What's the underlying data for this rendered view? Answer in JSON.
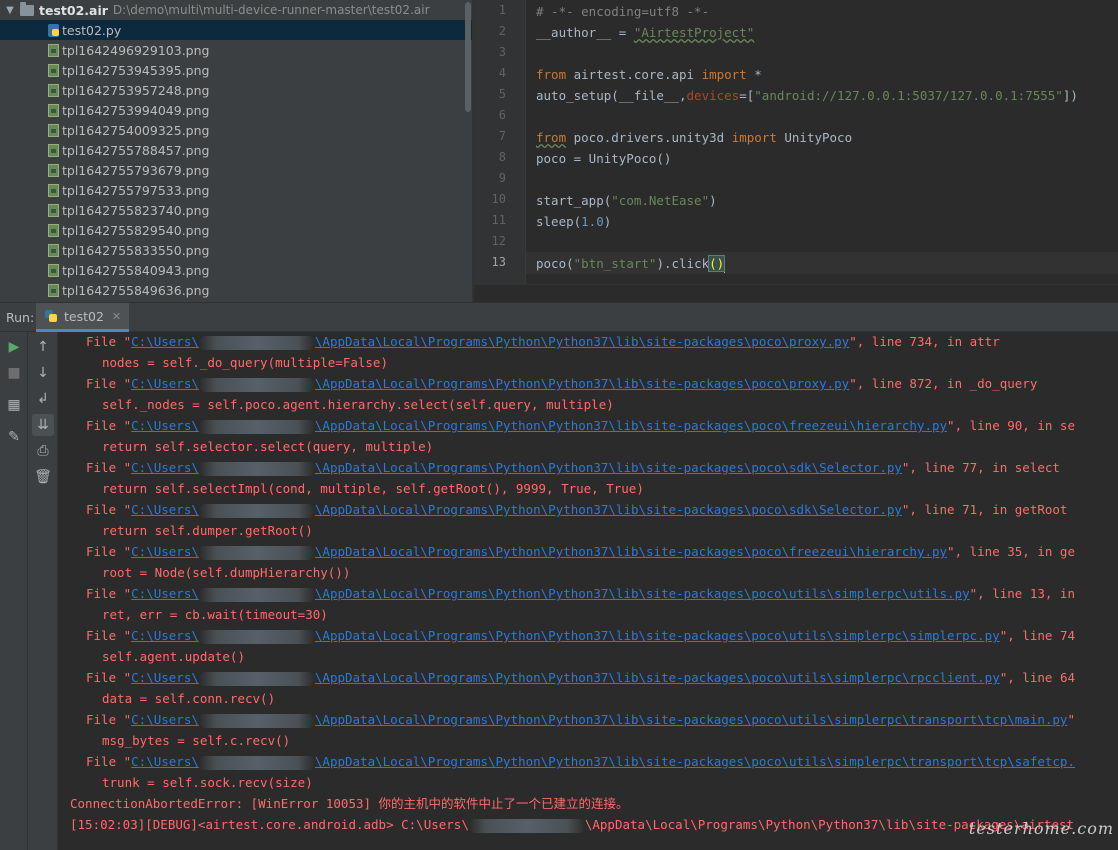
{
  "project_tree": {
    "root_name": "test02.air",
    "root_path": "D:\\demo\\multi\\multi-device-runner-master\\test02.air",
    "files": [
      {
        "name": "test02.py",
        "type": "py",
        "selected": true
      },
      {
        "name": "tpl1642496929103.png",
        "type": "png"
      },
      {
        "name": "tpl1642753945395.png",
        "type": "png"
      },
      {
        "name": "tpl1642753957248.png",
        "type": "png"
      },
      {
        "name": "tpl1642753994049.png",
        "type": "png"
      },
      {
        "name": "tpl1642754009325.png",
        "type": "png"
      },
      {
        "name": "tpl1642755788457.png",
        "type": "png"
      },
      {
        "name": "tpl1642755793679.png",
        "type": "png"
      },
      {
        "name": "tpl1642755797533.png",
        "type": "png"
      },
      {
        "name": "tpl1642755823740.png",
        "type": "png"
      },
      {
        "name": "tpl1642755829540.png",
        "type": "png"
      },
      {
        "name": "tpl1642755833550.png",
        "type": "png"
      },
      {
        "name": "tpl1642755840943.png",
        "type": "png"
      },
      {
        "name": "tpl1642755849636.png",
        "type": "png"
      }
    ]
  },
  "editor": {
    "line_numbers": [
      "1",
      "2",
      "3",
      "4",
      "5",
      "6",
      "7",
      "8",
      "9",
      "10",
      "11",
      "12",
      "13"
    ],
    "current_line": "13",
    "code": {
      "l1": "# -*- encoding=utf8 -*-",
      "l2a": "__author__ = ",
      "l2b": "\"AirtestProject\"",
      "l4a": "from",
      "l4b": " airtest.core.api ",
      "l4c": "import",
      "l4d": " *",
      "l5a": "auto_setup(__file__,",
      "l5b": "devices",
      "l5c": "=[",
      "l5d": "\"android://127.0.0.1:5037/127.0.0.1:7555\"",
      "l5e": "])",
      "l7a": "from",
      "l7b": " poco.drivers.unity3d ",
      "l7c": "import",
      "l7d": " UnityPoco",
      "l8": "poco = UnityPoco()",
      "l10a": "start_app(",
      "l10b": "\"com.NetEase\"",
      "l10c": ")",
      "l11a": "sleep(",
      "l11b": "1.0",
      "l11c": ")",
      "l13a": "poco(",
      "l13b": "\"btn_start\"",
      "l13c": ").click",
      "l13d": "()"
    }
  },
  "run_window": {
    "label": "Run:",
    "tab_label": "test02",
    "toolbar_icons": [
      "run-icon",
      "stop-icon",
      "layout-icon",
      "pin-icon",
      "up-arrow-icon",
      "down-arrow-icon",
      "soft-wrap-icon",
      "scroll-to-end-icon",
      "print-icon",
      "trash-icon"
    ]
  },
  "console": {
    "file_prefix": "File \"",
    "user_path_start": "C:\\Users\\",
    "frames": [
      {
        "path": "\\AppData\\Local\\Programs\\Python\\Python37\\lib\\site-packages\\poco\\proxy.py",
        "suffix": "\", line 734, in attr",
        "code": "nodes = self._do_query(multiple=False)"
      },
      {
        "path": "\\AppData\\Local\\Programs\\Python\\Python37\\lib\\site-packages\\poco\\proxy.py",
        "suffix": "\", line 872, in _do_query",
        "code": "self._nodes = self.poco.agent.hierarchy.select(self.query, multiple)"
      },
      {
        "path": "\\AppData\\Local\\Programs\\Python\\Python37\\lib\\site-packages\\poco\\freezeui\\hierarchy.py",
        "suffix": "\", line 90, in se",
        "code": "return self.selector.select(query, multiple)"
      },
      {
        "path": "\\AppData\\Local\\Programs\\Python\\Python37\\lib\\site-packages\\poco\\sdk\\Selector.py",
        "suffix": "\", line 77, in select",
        "code": "return self.selectImpl(cond, multiple, self.getRoot(), 9999, True, True)"
      },
      {
        "path": "\\AppData\\Local\\Programs\\Python\\Python37\\lib\\site-packages\\poco\\sdk\\Selector.py",
        "suffix": "\", line 71, in getRoot",
        "code": "return self.dumper.getRoot()"
      },
      {
        "path": "\\AppData\\Local\\Programs\\Python\\Python37\\lib\\site-packages\\poco\\freezeui\\hierarchy.py",
        "suffix": "\", line 35, in ge",
        "code": "root = Node(self.dumpHierarchy())"
      },
      {
        "path": "\\AppData\\Local\\Programs\\Python\\Python37\\lib\\site-packages\\poco\\utils\\simplerpc\\utils.py",
        "suffix": "\", line 13, in",
        "code": "ret, err = cb.wait(timeout=30)"
      },
      {
        "path": "\\AppData\\Local\\Programs\\Python\\Python37\\lib\\site-packages\\poco\\utils\\simplerpc\\simplerpc.py",
        "suffix": "\", line 74",
        "code": "self.agent.update()"
      },
      {
        "path": "\\AppData\\Local\\Programs\\Python\\Python37\\lib\\site-packages\\poco\\utils\\simplerpc\\rpcclient.py",
        "suffix": "\", line 64",
        "code": "data = self.conn.recv()"
      },
      {
        "path": "\\AppData\\Local\\Programs\\Python\\Python37\\lib\\site-packages\\poco\\utils\\simplerpc\\transport\\tcp\\main.py",
        "suffix": "\"",
        "code": "msg_bytes = self.c.recv()"
      },
      {
        "path": "\\AppData\\Local\\Programs\\Python\\Python37\\lib\\site-packages\\poco\\utils\\simplerpc\\transport\\tcp\\safetcp.",
        "suffix": "",
        "code": "trunk = self.sock.recv(size)"
      }
    ],
    "error": "ConnectionAbortedError: [WinError 10053] 你的主机中的软件中止了一个已建立的连接。",
    "debug_prefix": "[15:02:03][DEBUG]<airtest.core.android.adb> C:\\Users\\",
    "debug_suffix": "\\AppData\\Local\\Programs\\Python\\Python37\\lib\\site-packages\\airtest"
  },
  "watermark": "testerhome.com",
  "colors": {
    "error_red": "#ff6b68",
    "link_blue": "#287bde",
    "keyword": "#cc7832",
    "string": "#6a8759",
    "number": "#6897bb"
  }
}
